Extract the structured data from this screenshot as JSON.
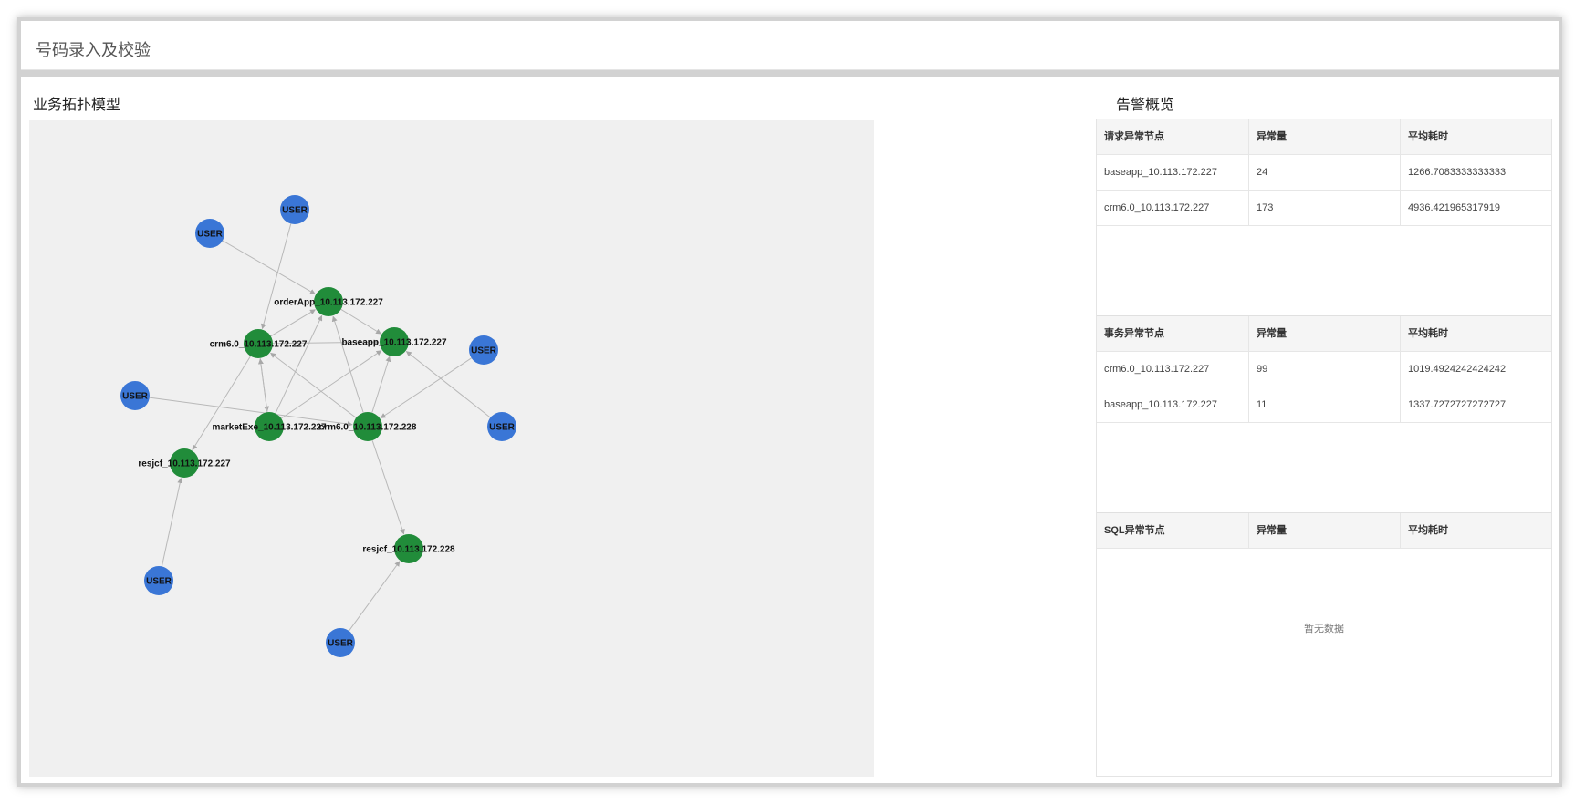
{
  "header": {
    "title": "号码录入及校验"
  },
  "topology": {
    "title": "业务拓扑模型",
    "colors": {
      "user": "#3a76d6",
      "app": "#218c3a",
      "edge": "#b8b8b8"
    },
    "user_label": "USER",
    "app_labels": {
      "order": "orderApp_10.113.172.227",
      "crm227": "crm6.0_10.113.172.227",
      "base": "baseapp_10.113.172.227",
      "market": "marketExe_10.113.172.227",
      "crm228": "crm6.0_10.113.172.228",
      "resjcf227": "resjcf_10.113.172.227",
      "resjcf228": "resjcf_10.113.172.228"
    }
  },
  "alerts": {
    "title": "告警概览",
    "request": {
      "headers": [
        "请求异常节点",
        "异常量",
        "平均耗时"
      ],
      "rows": [
        [
          "baseapp_10.113.172.227",
          "24",
          "1266.7083333333333"
        ],
        [
          "crm6.0_10.113.172.227",
          "173",
          "4936.421965317919"
        ]
      ]
    },
    "transaction": {
      "headers": [
        "事务异常节点",
        "异常量",
        "平均耗时"
      ],
      "rows": [
        [
          "crm6.0_10.113.172.227",
          "99",
          "1019.4924242424242"
        ],
        [
          "baseapp_10.113.172.227",
          "11",
          "1337.7272727272727"
        ]
      ]
    },
    "sql": {
      "headers": [
        "SQL异常节点",
        "异常量",
        "平均耗时"
      ],
      "empty": "暂无数据"
    }
  }
}
